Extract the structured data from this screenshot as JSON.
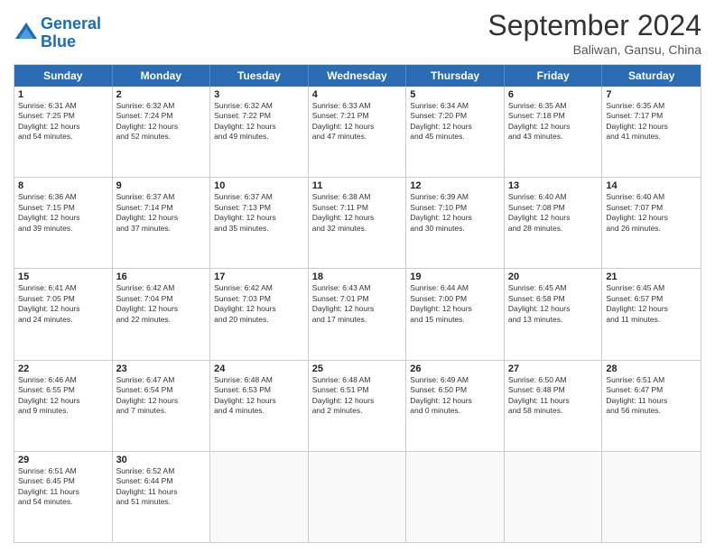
{
  "header": {
    "logo_line1": "General",
    "logo_line2": "Blue",
    "month_title": "September 2024",
    "location": "Baliwan, Gansu, China"
  },
  "weekdays": [
    "Sunday",
    "Monday",
    "Tuesday",
    "Wednesday",
    "Thursday",
    "Friday",
    "Saturday"
  ],
  "rows": [
    [
      {
        "day": "1",
        "lines": [
          "Sunrise: 6:31 AM",
          "Sunset: 7:25 PM",
          "Daylight: 12 hours",
          "and 54 minutes."
        ]
      },
      {
        "day": "2",
        "lines": [
          "Sunrise: 6:32 AM",
          "Sunset: 7:24 PM",
          "Daylight: 12 hours",
          "and 52 minutes."
        ]
      },
      {
        "day": "3",
        "lines": [
          "Sunrise: 6:32 AM",
          "Sunset: 7:22 PM",
          "Daylight: 12 hours",
          "and 49 minutes."
        ]
      },
      {
        "day": "4",
        "lines": [
          "Sunrise: 6:33 AM",
          "Sunset: 7:21 PM",
          "Daylight: 12 hours",
          "and 47 minutes."
        ]
      },
      {
        "day": "5",
        "lines": [
          "Sunrise: 6:34 AM",
          "Sunset: 7:20 PM",
          "Daylight: 12 hours",
          "and 45 minutes."
        ]
      },
      {
        "day": "6",
        "lines": [
          "Sunrise: 6:35 AM",
          "Sunset: 7:18 PM",
          "Daylight: 12 hours",
          "and 43 minutes."
        ]
      },
      {
        "day": "7",
        "lines": [
          "Sunrise: 6:35 AM",
          "Sunset: 7:17 PM",
          "Daylight: 12 hours",
          "and 41 minutes."
        ]
      }
    ],
    [
      {
        "day": "8",
        "lines": [
          "Sunrise: 6:36 AM",
          "Sunset: 7:15 PM",
          "Daylight: 12 hours",
          "and 39 minutes."
        ]
      },
      {
        "day": "9",
        "lines": [
          "Sunrise: 6:37 AM",
          "Sunset: 7:14 PM",
          "Daylight: 12 hours",
          "and 37 minutes."
        ]
      },
      {
        "day": "10",
        "lines": [
          "Sunrise: 6:37 AM",
          "Sunset: 7:13 PM",
          "Daylight: 12 hours",
          "and 35 minutes."
        ]
      },
      {
        "day": "11",
        "lines": [
          "Sunrise: 6:38 AM",
          "Sunset: 7:11 PM",
          "Daylight: 12 hours",
          "and 32 minutes."
        ]
      },
      {
        "day": "12",
        "lines": [
          "Sunrise: 6:39 AM",
          "Sunset: 7:10 PM",
          "Daylight: 12 hours",
          "and 30 minutes."
        ]
      },
      {
        "day": "13",
        "lines": [
          "Sunrise: 6:40 AM",
          "Sunset: 7:08 PM",
          "Daylight: 12 hours",
          "and 28 minutes."
        ]
      },
      {
        "day": "14",
        "lines": [
          "Sunrise: 6:40 AM",
          "Sunset: 7:07 PM",
          "Daylight: 12 hours",
          "and 26 minutes."
        ]
      }
    ],
    [
      {
        "day": "15",
        "lines": [
          "Sunrise: 6:41 AM",
          "Sunset: 7:05 PM",
          "Daylight: 12 hours",
          "and 24 minutes."
        ]
      },
      {
        "day": "16",
        "lines": [
          "Sunrise: 6:42 AM",
          "Sunset: 7:04 PM",
          "Daylight: 12 hours",
          "and 22 minutes."
        ]
      },
      {
        "day": "17",
        "lines": [
          "Sunrise: 6:42 AM",
          "Sunset: 7:03 PM",
          "Daylight: 12 hours",
          "and 20 minutes."
        ]
      },
      {
        "day": "18",
        "lines": [
          "Sunrise: 6:43 AM",
          "Sunset: 7:01 PM",
          "Daylight: 12 hours",
          "and 17 minutes."
        ]
      },
      {
        "day": "19",
        "lines": [
          "Sunrise: 6:44 AM",
          "Sunset: 7:00 PM",
          "Daylight: 12 hours",
          "and 15 minutes."
        ]
      },
      {
        "day": "20",
        "lines": [
          "Sunrise: 6:45 AM",
          "Sunset: 6:58 PM",
          "Daylight: 12 hours",
          "and 13 minutes."
        ]
      },
      {
        "day": "21",
        "lines": [
          "Sunrise: 6:45 AM",
          "Sunset: 6:57 PM",
          "Daylight: 12 hours",
          "and 11 minutes."
        ]
      }
    ],
    [
      {
        "day": "22",
        "lines": [
          "Sunrise: 6:46 AM",
          "Sunset: 6:55 PM",
          "Daylight: 12 hours",
          "and 9 minutes."
        ]
      },
      {
        "day": "23",
        "lines": [
          "Sunrise: 6:47 AM",
          "Sunset: 6:54 PM",
          "Daylight: 12 hours",
          "and 7 minutes."
        ]
      },
      {
        "day": "24",
        "lines": [
          "Sunrise: 6:48 AM",
          "Sunset: 6:53 PM",
          "Daylight: 12 hours",
          "and 4 minutes."
        ]
      },
      {
        "day": "25",
        "lines": [
          "Sunrise: 6:48 AM",
          "Sunset: 6:51 PM",
          "Daylight: 12 hours",
          "and 2 minutes."
        ]
      },
      {
        "day": "26",
        "lines": [
          "Sunrise: 6:49 AM",
          "Sunset: 6:50 PM",
          "Daylight: 12 hours",
          "and 0 minutes."
        ]
      },
      {
        "day": "27",
        "lines": [
          "Sunrise: 6:50 AM",
          "Sunset: 6:48 PM",
          "Daylight: 11 hours",
          "and 58 minutes."
        ]
      },
      {
        "day": "28",
        "lines": [
          "Sunrise: 6:51 AM",
          "Sunset: 6:47 PM",
          "Daylight: 11 hours",
          "and 56 minutes."
        ]
      }
    ],
    [
      {
        "day": "29",
        "lines": [
          "Sunrise: 6:51 AM",
          "Sunset: 6:45 PM",
          "Daylight: 11 hours",
          "and 54 minutes."
        ]
      },
      {
        "day": "30",
        "lines": [
          "Sunrise: 6:52 AM",
          "Sunset: 6:44 PM",
          "Daylight: 11 hours",
          "and 51 minutes."
        ]
      },
      {
        "day": "",
        "lines": []
      },
      {
        "day": "",
        "lines": []
      },
      {
        "day": "",
        "lines": []
      },
      {
        "day": "",
        "lines": []
      },
      {
        "day": "",
        "lines": []
      }
    ]
  ]
}
